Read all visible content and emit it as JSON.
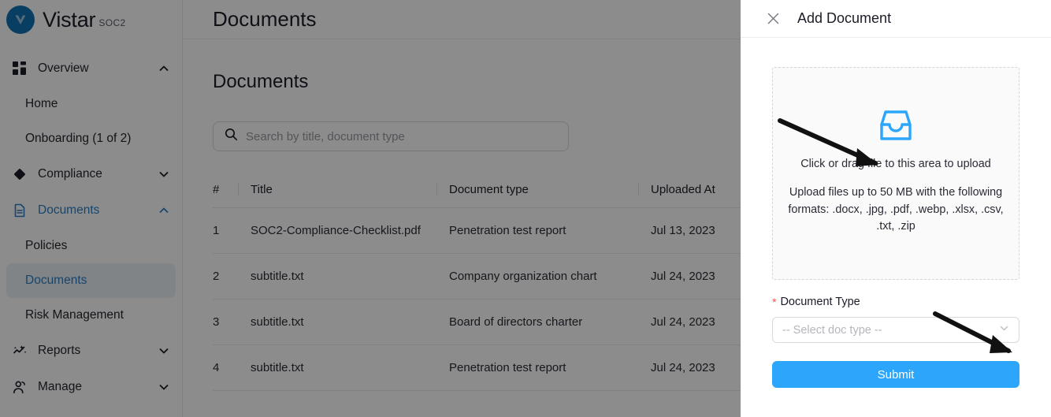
{
  "brand": {
    "name": "Vistar",
    "sub": "SOC2",
    "logo_icon": "vistar-v-logo",
    "color": "#1271b5"
  },
  "sidebar": {
    "groups": [
      {
        "label": "Overview",
        "icon": "grid-dashboard-icon",
        "chevron": "chevron-up-icon",
        "expanded": true,
        "active": false,
        "items": [
          {
            "label": "Home",
            "selected": false
          },
          {
            "label": "Onboarding (1 of 2)",
            "selected": false
          }
        ]
      },
      {
        "label": "Compliance",
        "icon": "diamond-icon",
        "chevron": "chevron-down-icon",
        "expanded": false,
        "active": false,
        "items": []
      },
      {
        "label": "Documents",
        "icon": "document-icon",
        "chevron": "chevron-up-icon",
        "expanded": true,
        "active": true,
        "items": [
          {
            "label": "Policies",
            "selected": false
          },
          {
            "label": "Documents",
            "selected": true
          },
          {
            "label": "Risk Management",
            "selected": false
          }
        ]
      },
      {
        "label": "Reports",
        "icon": "magic-sparkle-icon",
        "chevron": "chevron-down-icon",
        "expanded": false,
        "active": false,
        "items": []
      },
      {
        "label": "Manage",
        "icon": "people-icon",
        "chevron": "chevron-down-icon",
        "expanded": false,
        "active": false,
        "items": []
      }
    ]
  },
  "header": {
    "title": "Documents"
  },
  "main": {
    "section_title": "Documents",
    "search": {
      "placeholder": "Search by title, document type",
      "value": "",
      "icon": "search-icon"
    },
    "table": {
      "columns": [
        "#",
        "Title",
        "Document type",
        "Uploaded At"
      ],
      "rows": [
        {
          "num": "1",
          "title": "SOC2-Compliance-Checklist.pdf",
          "type": "Penetration test report",
          "uploaded": "Jul 13, 2023"
        },
        {
          "num": "2",
          "title": "subtitle.txt",
          "type": "Company organization chart",
          "uploaded": "Jul 24, 2023"
        },
        {
          "num": "3",
          "title": "subtitle.txt",
          "type": "Board of directors charter",
          "uploaded": "Jul 24, 2023"
        },
        {
          "num": "4",
          "title": "subtitle.txt",
          "type": "Penetration test report",
          "uploaded": "Jul 24, 2023"
        }
      ]
    }
  },
  "drawer": {
    "title": "Add Document",
    "close_icon": "close-x-icon",
    "dropzone": {
      "icon": "inbox-upload-icon",
      "icon_color": "#2ca6fb",
      "main_text": "Click or drag file to this area to upload",
      "hint_text": "Upload files up to 50 MB with the following formats: .docx, .jpg, .pdf, .webp, .xlsx, .csv, .txt, .zip"
    },
    "doc_type": {
      "label": "Document Type",
      "required_marker": "*",
      "required_color": "#ff4d4f",
      "placeholder": "-- Select doc type --",
      "value": "",
      "chevron_icon": "chevron-down-icon"
    },
    "submit": {
      "label": "Submit",
      "color": "#2ca6fb"
    }
  },
  "annotations": [
    {
      "name": "arrow-to-upload-icon",
      "target": "inbox-upload-icon"
    },
    {
      "name": "arrow-to-doc-type-select",
      "target": "doc-type-select"
    }
  ]
}
